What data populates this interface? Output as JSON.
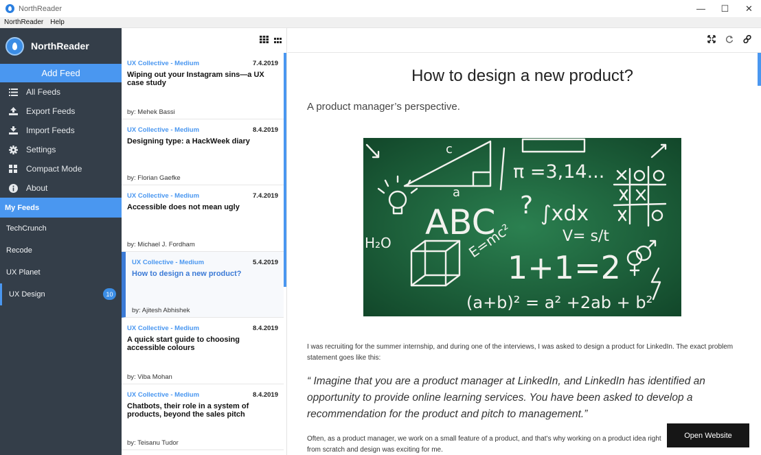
{
  "window": {
    "title": "NorthReader",
    "min": "—",
    "max": "☐",
    "close": "✕"
  },
  "menubar": [
    "NorthReader",
    "Help"
  ],
  "sidebar": {
    "brand": "NorthReader",
    "add_feed": "Add Feed",
    "menu": [
      {
        "label": "All Feeds",
        "icon": "list-icon"
      },
      {
        "label": "Export Feeds",
        "icon": "upload-icon"
      },
      {
        "label": "Import Feeds",
        "icon": "download-icon"
      },
      {
        "label": "Settings",
        "icon": "gear-icon"
      },
      {
        "label": "Compact Mode",
        "icon": "grid-icon"
      },
      {
        "label": "About",
        "icon": "info-icon"
      }
    ],
    "my_feeds": "My Feeds",
    "feeds": [
      {
        "label": "TechCrunch"
      },
      {
        "label": "Recode"
      },
      {
        "label": "UX Planet"
      },
      {
        "label": "UX Design",
        "count": "10"
      }
    ]
  },
  "articles": [
    {
      "source": "UX Collective - Medium",
      "date": "7.4.2019",
      "title": "Wiping out your Instagram sins—a UX case study",
      "author": "by: Mehek Bassi"
    },
    {
      "source": "UX Collective - Medium",
      "date": "8.4.2019",
      "title": "Designing type: a HackWeek diary",
      "author": "by: Florian Gaefke"
    },
    {
      "source": "UX Collective - Medium",
      "date": "7.4.2019",
      "title": "Accessible does not mean ugly",
      "author": "by: Michael J. Fordham"
    },
    {
      "source": "UX Collective - Medium",
      "date": "5.4.2019",
      "title": "How to design a new product?",
      "author": "by: Ajitesh Abhishek"
    },
    {
      "source": "UX Collective - Medium",
      "date": "8.4.2019",
      "title": "A quick start guide to choosing accessible colours",
      "author": "by: Viba Mohan"
    },
    {
      "source": "UX Collective - Medium",
      "date": "8.4.2019",
      "title": "Chatbots, their role in a system of products, beyond the sales pitch",
      "author": "by: Teisanu Tudor"
    }
  ],
  "reader": {
    "title": "How to design a new product?",
    "subtitle": "A product manager’s perspective.",
    "paragraph1": "I was recruiting for the summer internship, and during one of the interviews, I was asked to design a product for LinkedIn. The exact problem statement goes like this:",
    "quote": "“ Imagine that you are a product manager at LinkedIn, and LinkedIn has identified an opportunity to provide online learning services. You have been asked to develop a recommendation for the product and pitch to management.”",
    "paragraph2": "Often, as a product manager, we work on a small feature of a product, and that’s why working on a product idea right from scratch and design was exciting for me.",
    "open_website": "Open Website",
    "chalk": {
      "abc": "ABC",
      "pi": "π =3,14...",
      "integral": "∫xdx",
      "eq": "1+1=2",
      "formula": "(a+b)² = a² +2ab + b²",
      "v": "V= s/t",
      "emc": "E=mc²",
      "h2o": "H₂O",
      "q": "?",
      "c": "c",
      "a": "a"
    }
  },
  "colors": {
    "sidebar": "#343e49",
    "accent": "#4a97f0",
    "board": "#1f6a3e"
  }
}
